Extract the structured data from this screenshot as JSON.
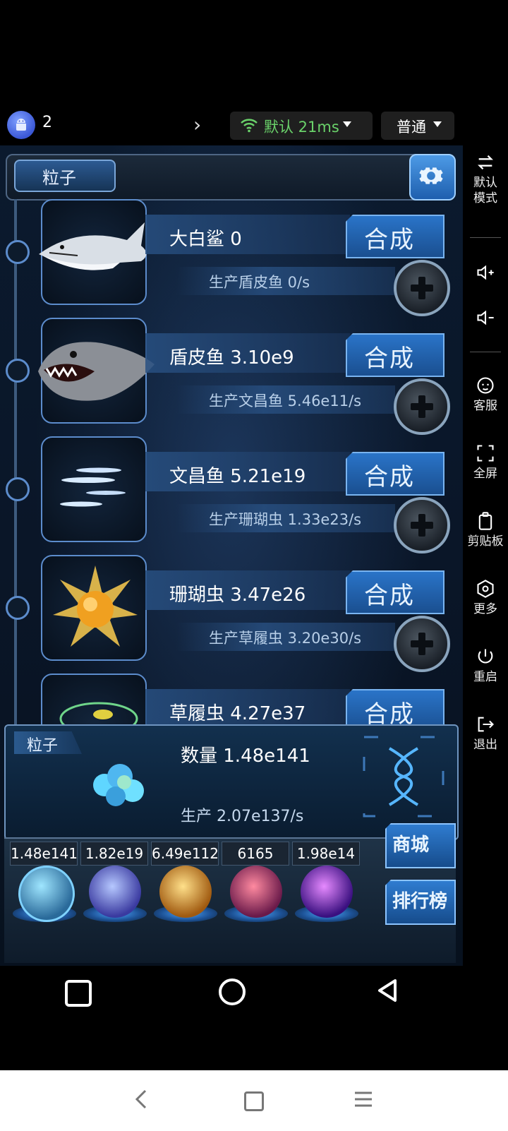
{
  "top_bar": {
    "device_count": "2",
    "network_label": "默认 21ms",
    "quality_label": "普通"
  },
  "game": {
    "title": "粒子",
    "creatures": [
      {
        "name": "大白鲨 0",
        "produce": "生产盾皮鱼 0/s",
        "action": "合成"
      },
      {
        "name": "盾皮鱼 3.10e9",
        "produce": "生产文昌鱼 5.46e11/s",
        "action": "合成"
      },
      {
        "name": "文昌鱼 5.21e19",
        "produce": "生产珊瑚虫 1.33e23/s",
        "action": "合成"
      },
      {
        "name": "珊瑚虫 3.47e26",
        "produce": "生产草履虫 3.20e30/s",
        "action": "合成"
      },
      {
        "name": "草履虫 4.27e37",
        "action": "合成"
      }
    ],
    "panel": {
      "tag": "粒子",
      "quantity": "数量 1.48e141",
      "production": "生产 2.07e137/s"
    },
    "resources": [
      "1.48e141",
      "1.82e19",
      "6.49e112",
      "6165",
      "1.98e14"
    ],
    "shop_label": "商城",
    "rank_label": "排行榜"
  },
  "side_panel": {
    "items": [
      {
        "label": "默认\n模式",
        "icon": "swap-icon"
      },
      {
        "label": "",
        "icon": "volume-up-icon"
      },
      {
        "label": "",
        "icon": "volume-down-icon"
      },
      {
        "label": "客服",
        "icon": "customer-service-icon"
      },
      {
        "label": "全屏",
        "icon": "fullscreen-icon"
      },
      {
        "label": "剪贴板",
        "icon": "clipboard-icon"
      },
      {
        "label": "更多",
        "icon": "more-icon"
      },
      {
        "label": "重启",
        "icon": "power-icon"
      },
      {
        "label": "退出",
        "icon": "exit-icon"
      }
    ]
  },
  "colors": {
    "network_green": "#6ad26a",
    "accent_blue": "#2a74c8"
  }
}
